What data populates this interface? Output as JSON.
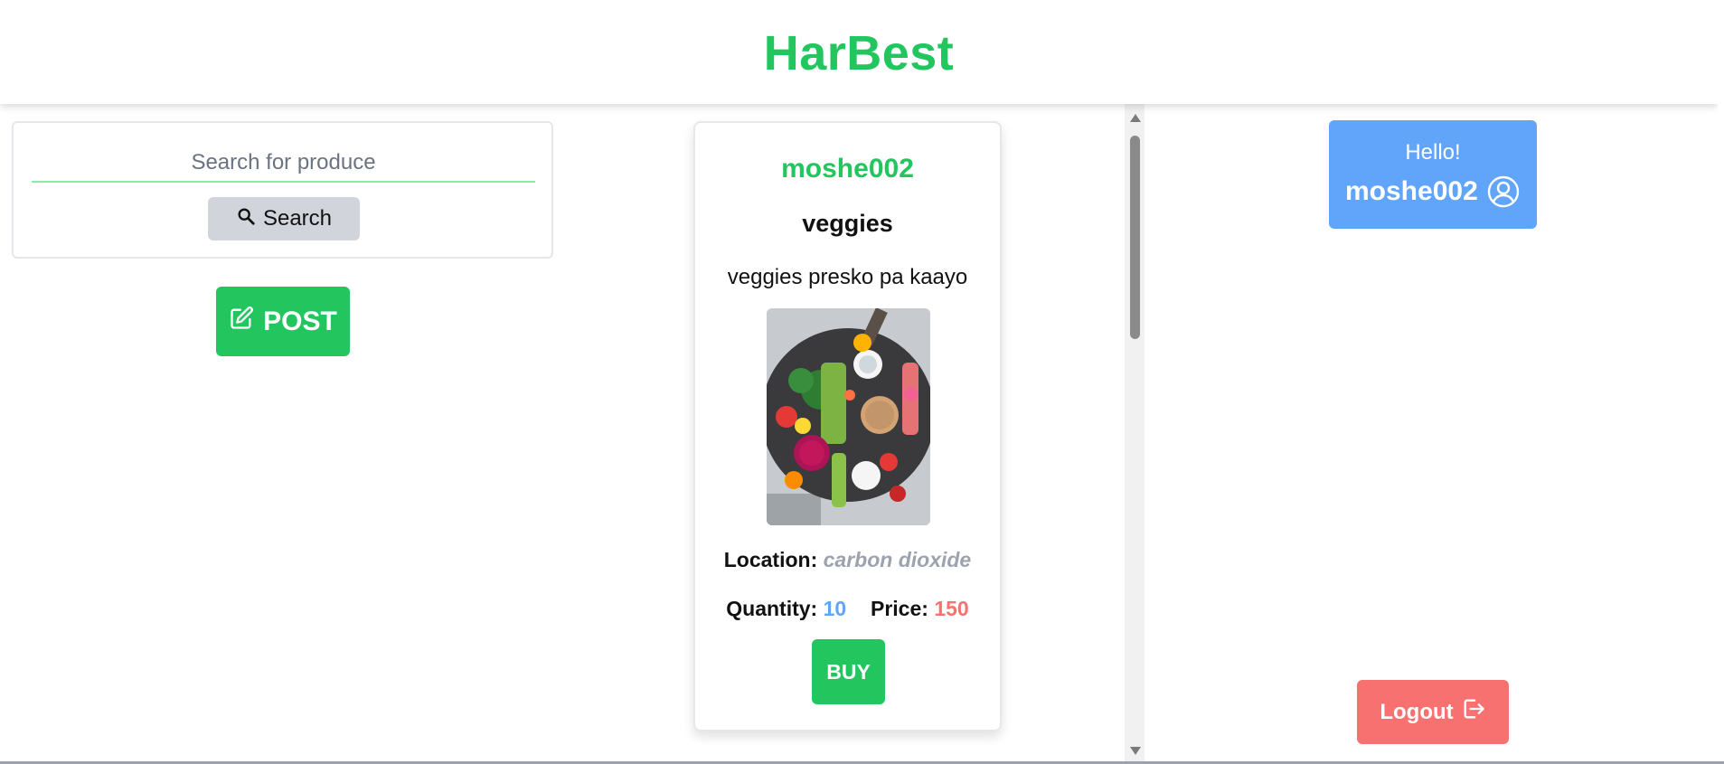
{
  "header": {
    "brand": "HarBest"
  },
  "search": {
    "placeholder": "Search for produce",
    "value": "",
    "button_label": "Search",
    "button_icon": "search-icon"
  },
  "actions": {
    "post_label": "POST",
    "post_icon": "edit-icon"
  },
  "post": {
    "user": "moshe002",
    "title": "veggies",
    "description": "veggies presko pa kaayo",
    "image_icon": "veggie-platter-image",
    "location_label": "Location:",
    "location_value": "carbon dioxide",
    "quantity_label": "Quantity:",
    "quantity_value": "10",
    "price_label": "Price:",
    "price_value": "150",
    "buy_label": "BUY"
  },
  "user_panel": {
    "greeting": "Hello!",
    "username": "moshe002",
    "icon": "user-circle-icon"
  },
  "logout": {
    "label": "Logout",
    "icon": "logout-icon"
  },
  "colors": {
    "brand_green": "#22c55e",
    "panel_blue": "#60a5fa",
    "logout_red": "#f87171",
    "muted_gray": "#9ca3af",
    "search_button_gray": "#d1d5db"
  }
}
